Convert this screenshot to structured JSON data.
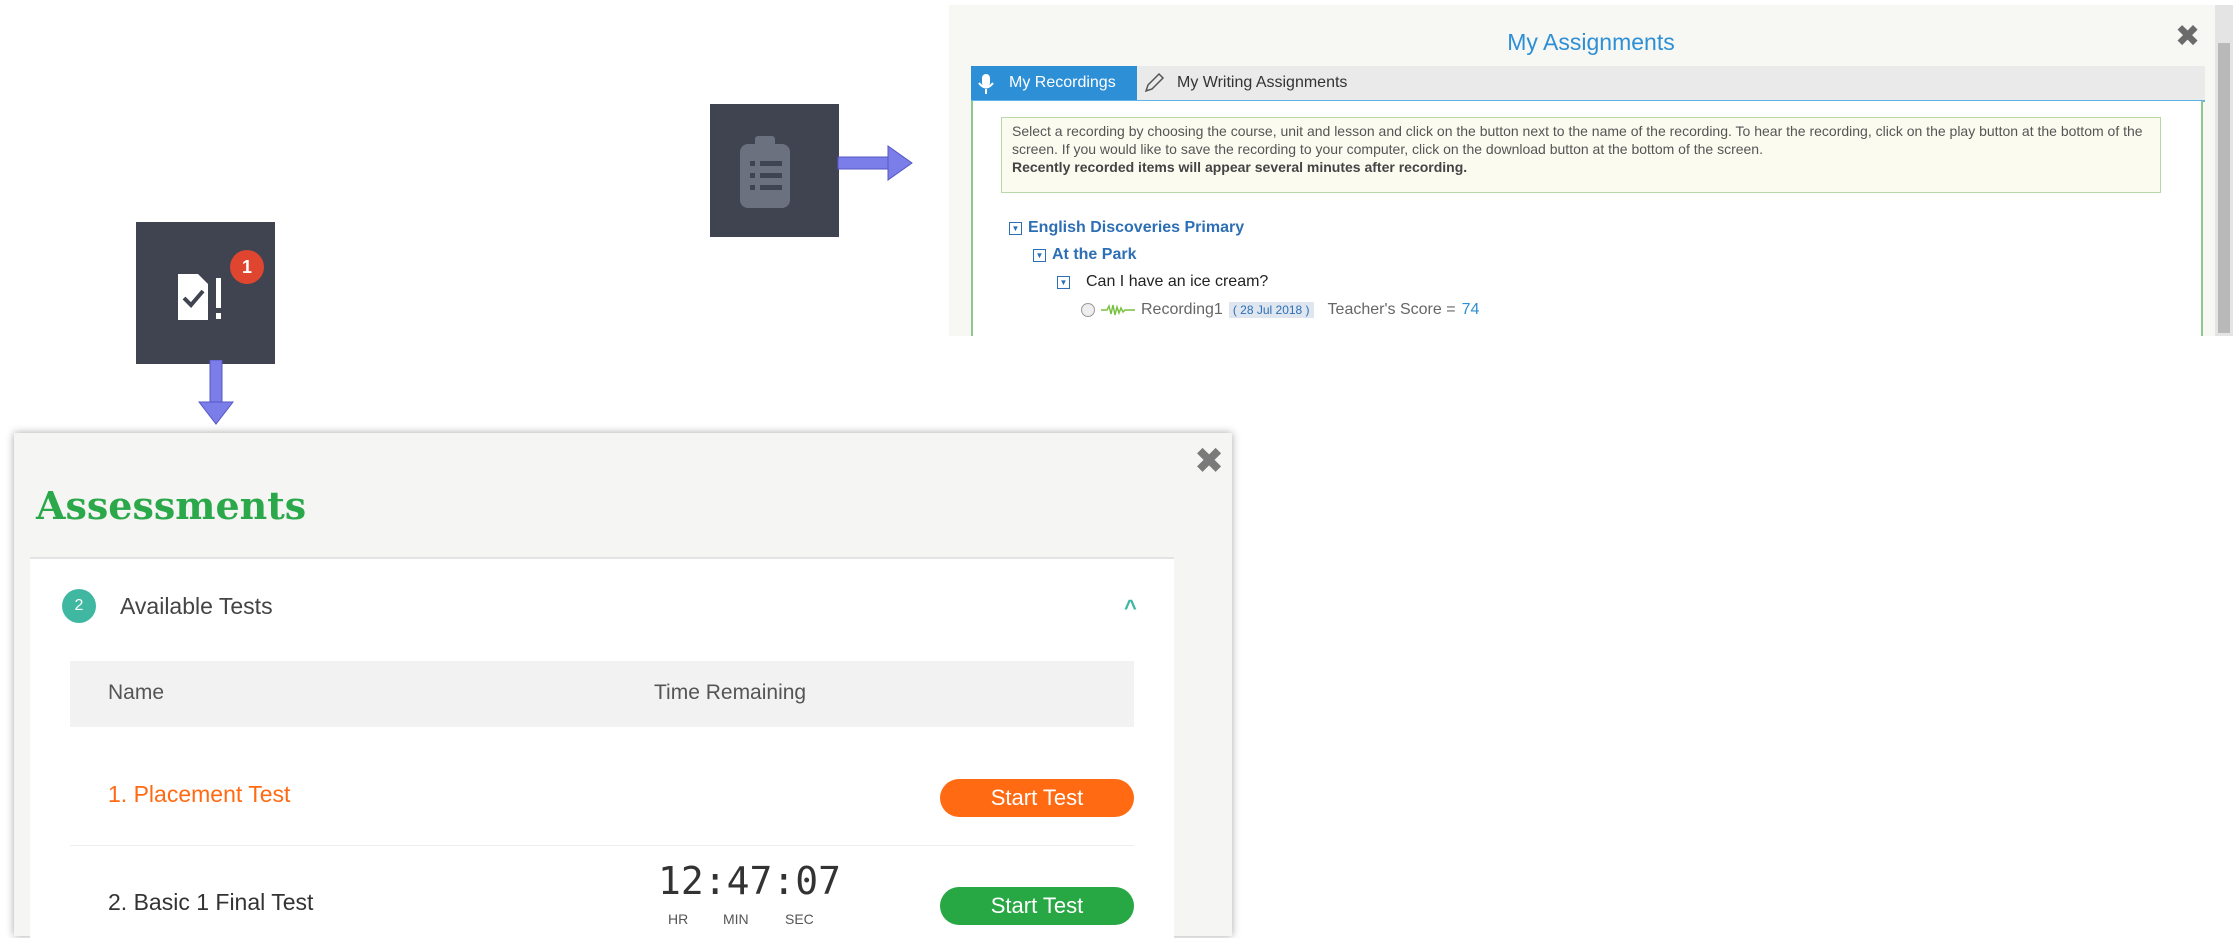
{
  "assignments": {
    "title": "My Assignments",
    "close": "✖",
    "tabs": {
      "recordings": "My Recordings",
      "writing": "My Writing Assignments"
    },
    "instructions": "Select a recording by choosing the course, unit and lesson and click on the button next to the name of the recording. To hear the recording, click on the play button at the bottom of the screen. If you would like to save the recording to your computer, click on the download button at the bottom of the screen.",
    "instructions_bold": "Recently recorded items will appear several minutes after recording.",
    "course": "English Discoveries Primary",
    "unit": "At the Park",
    "lesson": "Can I have an ice cream?",
    "recording": {
      "name": "Recording1",
      "date": "( 28 Jul 2018 )",
      "score_label": "Teacher's Score =",
      "score": "74"
    }
  },
  "assessments": {
    "badge": "1",
    "title": "Assessments",
    "close": "✖",
    "section": {
      "count": "2",
      "label": "Available Tests",
      "chevron": "^"
    },
    "columns": {
      "name": "Name",
      "time": "Time Remaining"
    },
    "rows": [
      {
        "number": "1.",
        "name": "Placement Test",
        "button": "Start Test"
      },
      {
        "number": "2.",
        "name": "Basic 1 Final Test",
        "button": "Start Test",
        "timer": "12:47:07",
        "hr": "HR",
        "min": "MIN",
        "sec": "SEC"
      }
    ]
  },
  "colors": {
    "accent_blue": "#2d8fd5",
    "assess_green": "#2aa84a",
    "orange": "#ff6a13",
    "button_green": "#28a745",
    "teal": "#3fb7a1",
    "tile": "#3f4450",
    "arrow": "#7b7ee8"
  }
}
